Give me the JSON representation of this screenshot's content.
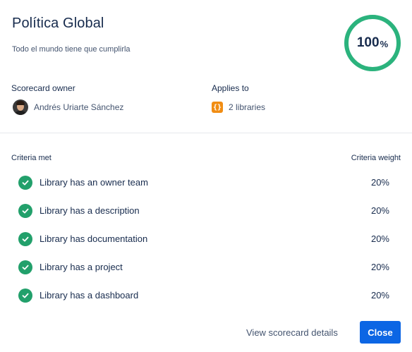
{
  "header": {
    "title": "Política Global",
    "subtitle": "Todo el mundo tiene que cumplirla"
  },
  "score": {
    "value": "100",
    "unit": "%",
    "fraction": 1.0,
    "ring_color": "#2bb37d"
  },
  "meta": {
    "owner_label": "Scorecard owner",
    "owner_name": "Andrés Uriarte Sánchez",
    "applies_label": "Applies to",
    "applies_value": "2 libraries",
    "applies_icon_glyph": "{}",
    "applies_icon_color": "#f18d13"
  },
  "criteria": {
    "met_header": "Criteria met",
    "weight_header": "Criteria weight",
    "items": [
      {
        "label": "Library has an owner team",
        "weight": "20%"
      },
      {
        "label": "Library has a description",
        "weight": "20%"
      },
      {
        "label": "Library has documentation",
        "weight": "20%"
      },
      {
        "label": "Library has a project",
        "weight": "20%"
      },
      {
        "label": "Library has a dashboard",
        "weight": "20%"
      }
    ]
  },
  "footer": {
    "details_label": "View scorecard details",
    "close_label": "Close"
  },
  "colors": {
    "check": "#22a06b",
    "primary": "#0c66e4"
  }
}
